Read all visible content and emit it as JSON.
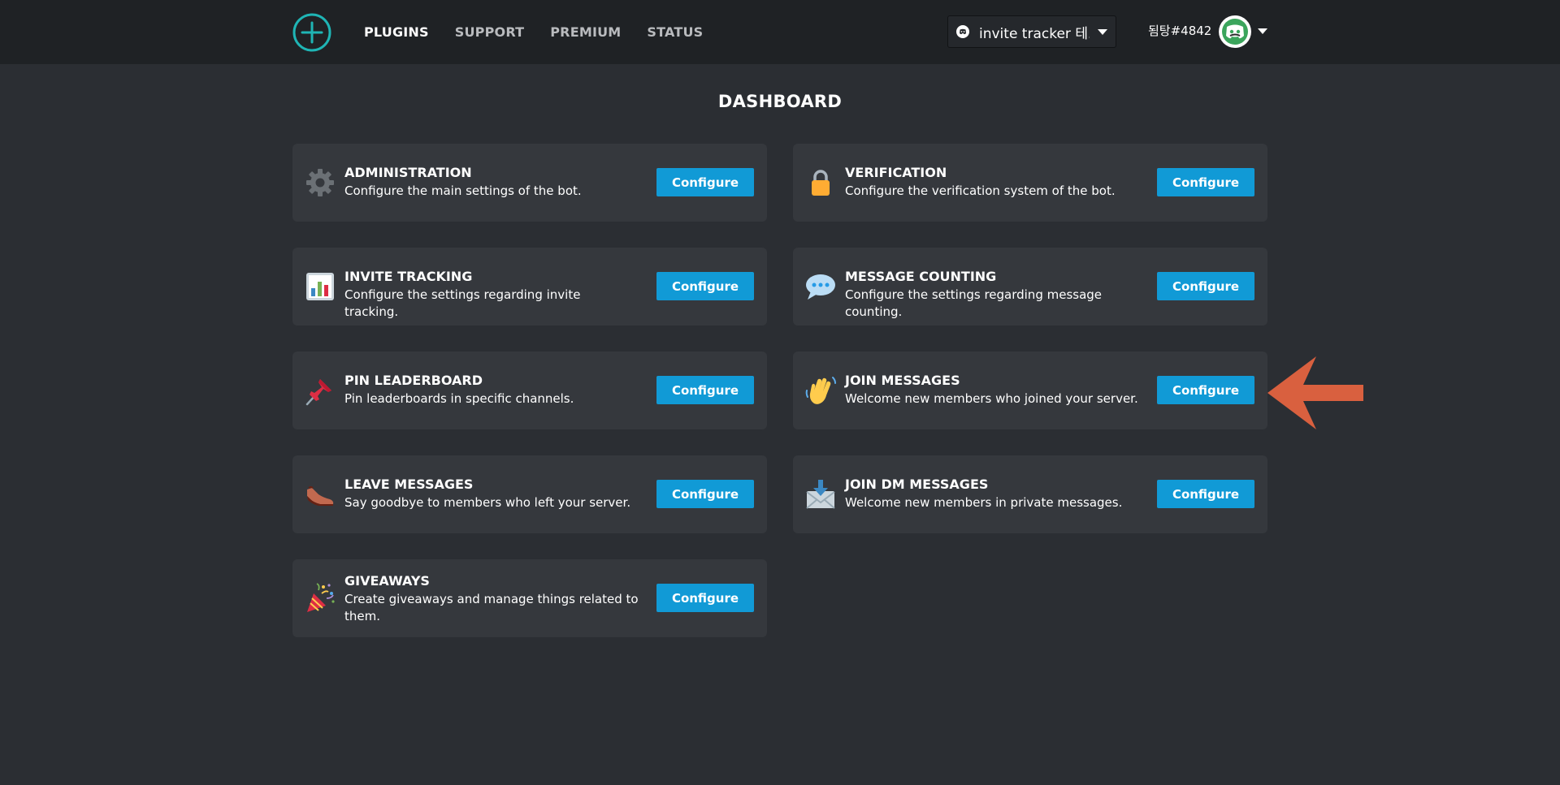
{
  "header": {
    "nav": [
      "PLUGINS",
      "SUPPORT",
      "PREMIUM",
      "STATUS"
    ],
    "active_nav": "PLUGINS",
    "server_selector": {
      "value": "invite tracker 테..."
    },
    "user": {
      "name": "됨탕#4842"
    }
  },
  "main": {
    "title": "DASHBOARD",
    "configure_label": "Configure",
    "plugins": [
      {
        "title": "ADMINISTRATION",
        "description": "Configure the main settings of the bot.",
        "icon": "gear-icon"
      },
      {
        "title": "VERIFICATION",
        "description": "Configure the verification system of the bot.",
        "icon": "lock-icon"
      },
      {
        "title": "INVITE TRACKING",
        "description": "Configure the settings regarding invite tracking.",
        "icon": "bar-chart-icon"
      },
      {
        "title": "MESSAGE COUNTING",
        "description": "Configure the settings regarding message counting.",
        "icon": "speech-bubble-icon"
      },
      {
        "title": "PIN LEADERBOARD",
        "description": "Pin leaderboards in specific channels.",
        "icon": "pushpin-icon"
      },
      {
        "title": "JOIN MESSAGES",
        "description": "Welcome new members who joined your server.",
        "icon": "waving-hand-icon"
      },
      {
        "title": "LEAVE MESSAGES",
        "description": "Say goodbye to members who left your server.",
        "icon": "shoe-icon"
      },
      {
        "title": "JOIN DM MESSAGES",
        "description": "Welcome new members in private messages.",
        "icon": "incoming-envelope-icon"
      },
      {
        "title": "GIVEAWAYS",
        "description": "Create giveaways and manage things related to them.",
        "icon": "party-popper-icon"
      }
    ]
  },
  "colors": {
    "accent": "#119ad6",
    "logo": "#1fb5b5",
    "arrow": "#d9603f",
    "background": "#2b2e33",
    "navbar": "#1f2225",
    "card": "#35383d"
  }
}
